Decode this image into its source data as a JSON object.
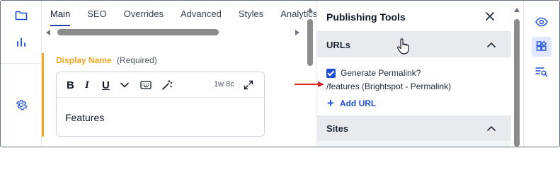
{
  "left_rail": {
    "icons": [
      "folder-icon",
      "bar-chart-icon",
      "gear-icon"
    ]
  },
  "tabs": [
    {
      "label": "Main",
      "active": true
    },
    {
      "label": "SEO"
    },
    {
      "label": "Overrides"
    },
    {
      "label": "Advanced"
    },
    {
      "label": "Styles"
    },
    {
      "label": "Analytics"
    }
  ],
  "field": {
    "label": "Display Name",
    "required_note": "(Required)",
    "toolbar": {
      "bold": "B",
      "italic": "I",
      "underline": "U",
      "count": "1w 8c"
    },
    "content": "Features"
  },
  "publishing": {
    "title": "Publishing Tools",
    "sections": {
      "urls_label": "URLs",
      "sites_label": "Sites"
    },
    "generate_permalink_label": "Generate Permalink?",
    "generate_permalink_checked": true,
    "permalink": "/features (Brightspot - Permalink)",
    "add_url_label": "Add URL"
  },
  "right_rail": {
    "icons": [
      "eye-icon",
      "widgets-icon",
      "search-list-icon"
    ]
  },
  "colors": {
    "accent_orange": "#f5a623",
    "primary_blue": "#1d4ed8",
    "annotation_red": "#dc2626"
  }
}
